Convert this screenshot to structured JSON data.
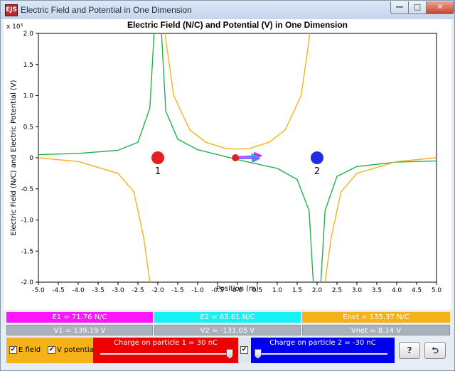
{
  "window": {
    "title": "Electric Field and Potential in One Dimension",
    "icon_label": "EJS"
  },
  "titlebar_buttons": {
    "minimize": "—",
    "maximize": "□",
    "close": "✕"
  },
  "chart_data": {
    "type": "line",
    "title": "Electric Field (N/C) and Potential (V) in One Dimension",
    "xlabel": "Position (m)",
    "ylabel": "Electric Field (N/C) and Electric Potential (V)",
    "y_multiplier": "x 10³",
    "xlim": [
      -5.0,
      5.0
    ],
    "ylim": [
      -2.0,
      2.0
    ],
    "x_ticks": [
      "-5.0",
      "-4.5",
      "-4.0",
      "-3.5",
      "-3.0",
      "-2.5",
      "-2.0",
      "-1.5",
      "-1.0",
      "-0.5",
      "0.0",
      "0.5",
      "1.0",
      "1.5",
      "2.0",
      "2.5",
      "3.0",
      "3.5",
      "4.0",
      "4.5",
      "5.0"
    ],
    "y_ticks": [
      "2.0",
      "1.5",
      "1.0",
      "0.5",
      "0",
      "-0.5",
      "-1.0",
      "-1.5",
      "-2.0"
    ],
    "grid": false,
    "series": [
      {
        "color": "#22b14c",
        "x": [
          -5.0,
          -4.0,
          -3.0,
          -2.5,
          -2.2,
          -2.05,
          -1.95,
          -1.8,
          -1.5,
          -1.0,
          -0.5,
          0.0,
          0.5,
          1.0,
          1.5,
          1.8,
          1.95,
          2.05,
          2.2,
          2.5,
          3.0,
          4.0,
          5.0
        ],
        "values": [
          0.05,
          0.07,
          0.12,
          0.25,
          0.8,
          2.5,
          2.5,
          0.75,
          0.3,
          0.13,
          0.05,
          -0.03,
          -0.1,
          -0.17,
          -0.35,
          -0.85,
          -2.5,
          -2.5,
          -0.85,
          -0.3,
          -0.14,
          -0.07,
          -0.05
        ]
      },
      {
        "color": "#f5b21a",
        "x": [
          -5.0,
          -4.0,
          -3.0,
          -2.6,
          -2.35,
          -2.2,
          -2.1
        ],
        "values": [
          0.0,
          -0.06,
          -0.25,
          -0.55,
          -1.3,
          -2.0,
          -2.5
        ]
      },
      {
        "color": "#f5b21a",
        "x": [
          -1.9,
          -1.8,
          -1.6,
          -1.2,
          -0.8,
          -0.3,
          0.0,
          0.3,
          0.8,
          1.2,
          1.6,
          1.8,
          1.9
        ],
        "values": [
          2.5,
          1.9,
          1.0,
          0.45,
          0.25,
          0.15,
          0.14,
          0.15,
          0.25,
          0.45,
          1.0,
          1.9,
          2.5
        ]
      },
      {
        "color": "#f5b21a",
        "x": [
          2.1,
          2.2,
          2.35,
          2.6,
          3.0,
          4.0,
          5.0
        ],
        "values": [
          -2.5,
          -2.0,
          -1.3,
          -0.55,
          -0.25,
          -0.06,
          0.0
        ]
      }
    ],
    "particles": [
      {
        "label": "1",
        "x": -2.0,
        "color": "#e31f1f"
      },
      {
        "label": "2",
        "x": 2.0,
        "color": "#1f2ee3"
      }
    ],
    "probe": {
      "x": -0.05,
      "color": "#e31f1f"
    },
    "field_arrows": [
      {
        "color": "#ff00ff",
        "dx": 0.64
      },
      {
        "color": "#00d8e0",
        "dx": 0.58
      },
      {
        "color": "#7070ff",
        "dx": 0.6
      }
    ]
  },
  "readouts": {
    "e1": "E1 = 71.76 N/C",
    "e2": "E2 = 63.61 N/C",
    "enet": "Enet = 135.37 N/C",
    "v1": "V1 = 139.19 V",
    "v2": "V2 = -131.05 V",
    "vnet": "Vnet = 8.14 V"
  },
  "colors": {
    "e1": "#ff16ff",
    "e2": "#16f2f2",
    "enet": "#f5b21a",
    "charge1_panel": "#ee0000",
    "charge2_panel": "#0000ee",
    "options_panel": "#f5b21a"
  },
  "controls": {
    "e_field_label": "E field",
    "e_field_checked": true,
    "v_potential_label": "V potential",
    "v_potential_checked": true,
    "charge1_label": "Charge on particle 1 = 30 nC",
    "charge1_value": 30,
    "charge1_level": 0.98,
    "charge2_label": "Charge on particle 2 = -30 nC",
    "charge2_value": -30,
    "charge2_level": 0.02,
    "charge2_checked": true,
    "help_label": "?",
    "reset_label": "⮌"
  },
  "check_mark": "✔"
}
